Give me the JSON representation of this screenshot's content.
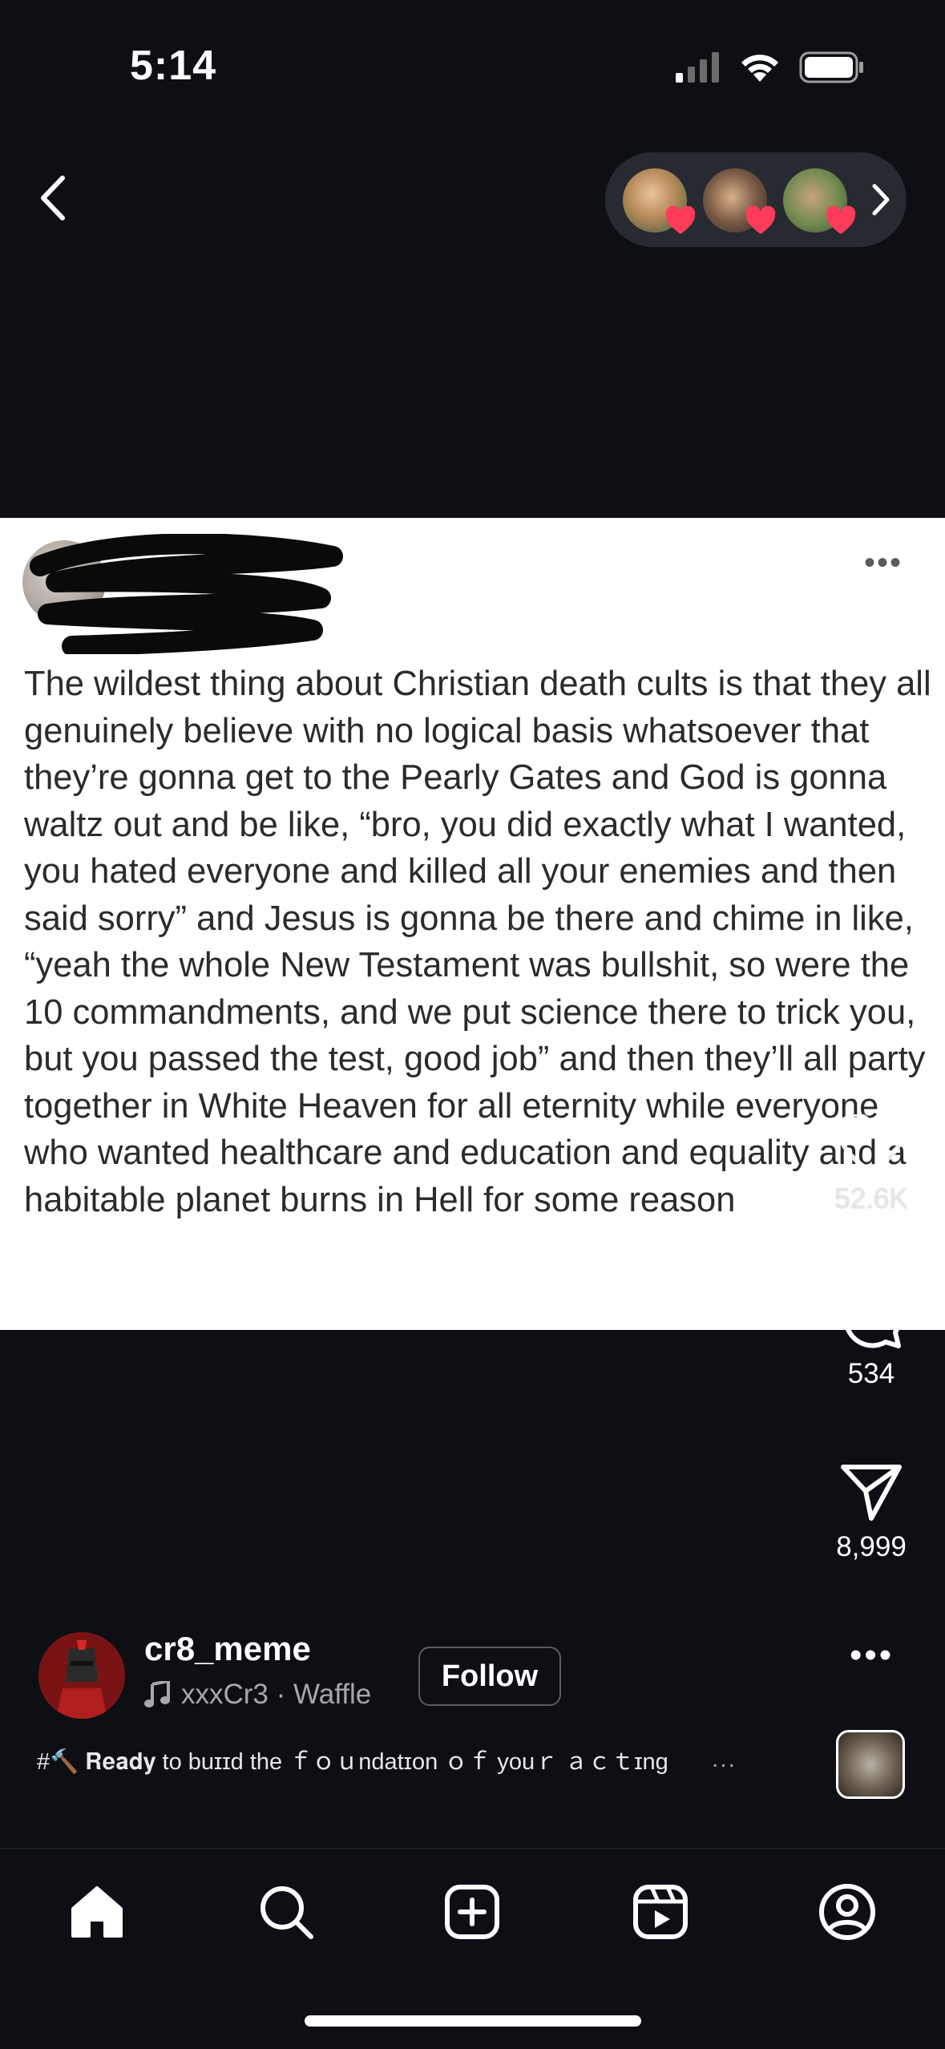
{
  "status_bar": {
    "time": "5:14",
    "icons": [
      "cellular-signal-icon",
      "wifi-icon",
      "battery-icon"
    ]
  },
  "header": {
    "back_icon": "chevron-left-icon",
    "viewers": [
      {
        "avatar": "viewer-avatar",
        "reaction": "heart-icon"
      },
      {
        "avatar": "viewer-avatar",
        "reaction": "heart-icon"
      },
      {
        "avatar": "viewer-avatar",
        "reaction": "heart-icon"
      }
    ],
    "viewers_chevron": "chevron-right-icon"
  },
  "post_image": {
    "more_label": "•••",
    "text": "The wildest thing about Christian death cults is that they all genuinely believe with no logical basis whatsoever that they’re gonna get to the Pearly Gates and God is gonna waltz out and be like, “bro, you did exactly what I wanted, you hated everyone and killed all your enemies and then said sorry” and Jesus is gonna be there and chime in like, “yeah the whole New Testament was bullshit, so were the 10 commandments, and we put science there to trick you, but you passed the test, good job” and then they’ll all party together in White Heaven for all eternity while everyone who wanted healthcare and education and equality and a habitable planet burns in Hell for some reason"
  },
  "actions": {
    "like_count": "52.6K",
    "comment_count": "534",
    "share_count": "8,999"
  },
  "owner": {
    "username": "cr8_meme",
    "audio_label": "xxxCr3 · Waffle",
    "follow_label": "Follow",
    "more_label": "•••",
    "caption": "#🔨 𝐑𝐞𝐚𝐝𝐲 to buɪɪd the ｆｏｕndatɪon ｏｆ youｒ ａｃｔɪng",
    "caption_more": "..."
  },
  "bottom_nav": {
    "items": [
      "home-icon",
      "search-icon",
      "create-icon",
      "reels-icon",
      "profile-icon"
    ]
  },
  "colors": {
    "background": "#0d0f14",
    "pill": "#272a30",
    "heart": "#ff3b5c"
  }
}
